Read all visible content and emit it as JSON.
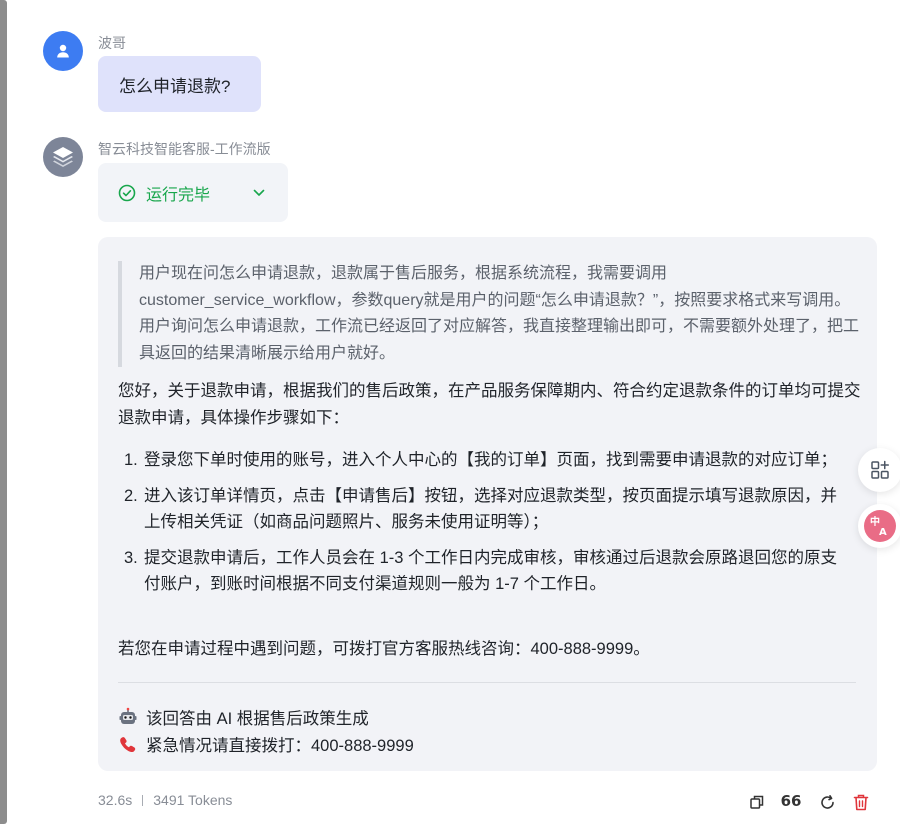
{
  "colors": {
    "user_avatar": "#3d7cf2",
    "user_bubble": "#dfe2fb",
    "status_green": "#18a64c",
    "card_bg": "#f2f3f7",
    "delete_red": "#e0353b",
    "translate_pink": "#e96c86"
  },
  "user_message": {
    "avatar_icon": "user-icon",
    "name": "波哥",
    "text": "怎么申请退款?"
  },
  "bot_message": {
    "avatar_icon": "layers-icon",
    "name": "智云科技智能客服-工作流版",
    "status": {
      "label": "运行完毕",
      "icon": "check-circle-icon",
      "expand_icon": "chevron-down-icon"
    },
    "thinking": "用户现在问怎么申请退款，退款属于售后服务，根据系统流程，我需要调用customer_service_workflow，参数query就是用户的问题“怎么申请退款？”，按照要求格式来写调用。用户询问怎么申请退款，工作流已经返回了对应解答，我直接整理输出即可，不需要额外处理了，把工具返回的结果清晰展示给用户就好。",
    "intro": "您好，关于退款申请，根据我们的售后政策，在产品服务保障期内、符合约定退款条件的订单均可提交退款申请，具体操作步骤如下：",
    "steps": [
      {
        "num": "1.",
        "text": "登录您下单时使用的账号，进入个人中心的【我的订单】页面，找到需要申请退款的对应订单；"
      },
      {
        "num": "2.",
        "text": "进入该订单详情页，点击【申请售后】按钮，选择对应退款类型，按页面提示填写退款原因，并上传相关凭证（如商品问题照片、服务未使用证明等）；"
      },
      {
        "num": "3.",
        "text": "提交退款申请后，工作人员会在 1-3 个工作日内完成审核，审核通过后退款会原路退回您的原支付账户，到账时间根据不同支付渠道规则一般为 1-7 个工作日。"
      }
    ],
    "hotline": "若您在申请过程中遇到问题，可拨打官方客服热线咨询：400-888-9999。",
    "footer": [
      {
        "icon": "robot-icon",
        "text": "该回答由 AI 根据售后政策生成"
      },
      {
        "icon": "telephone-icon",
        "text": "紧急情况请直接拨打：400-888-9999"
      }
    ],
    "meta": {
      "time": "32.6s",
      "tokens": "3491 Tokens"
    },
    "actions": {
      "quote_label": "66"
    }
  }
}
